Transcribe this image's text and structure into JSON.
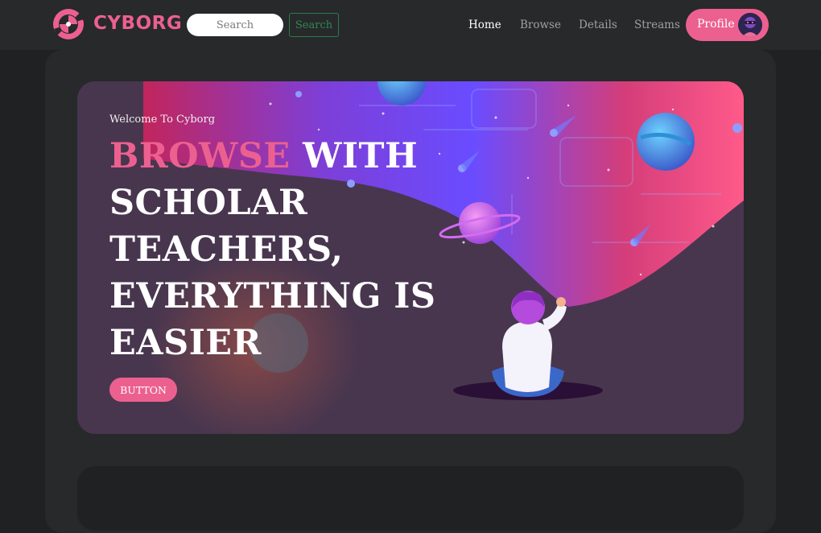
{
  "header": {
    "brand": "CYBORG",
    "search": {
      "placeholder": "Search",
      "button_label": "Search"
    },
    "nav": [
      {
        "label": "Home",
        "active": true
      },
      {
        "label": "Browse",
        "active": false
      },
      {
        "label": "Details",
        "active": false
      },
      {
        "label": "Streams",
        "active": false
      }
    ],
    "profile_label": "Profile"
  },
  "banner": {
    "welcome": "Welcome To Cyborg",
    "headline_accent": "BROWSE",
    "headline_rest": " WITH SCHOLAR TEACHERS, EVERYTHING IS EASIER",
    "button_label": "BUTTON"
  },
  "colors": {
    "accent": "#ec6090",
    "page_bg": "#1f2122",
    "panel_bg": "#27292a",
    "search_button_border": "#2e7d4f"
  },
  "icons": {
    "logo": "cyborg-logo-icon",
    "avatar": "user-avatar-icon"
  }
}
